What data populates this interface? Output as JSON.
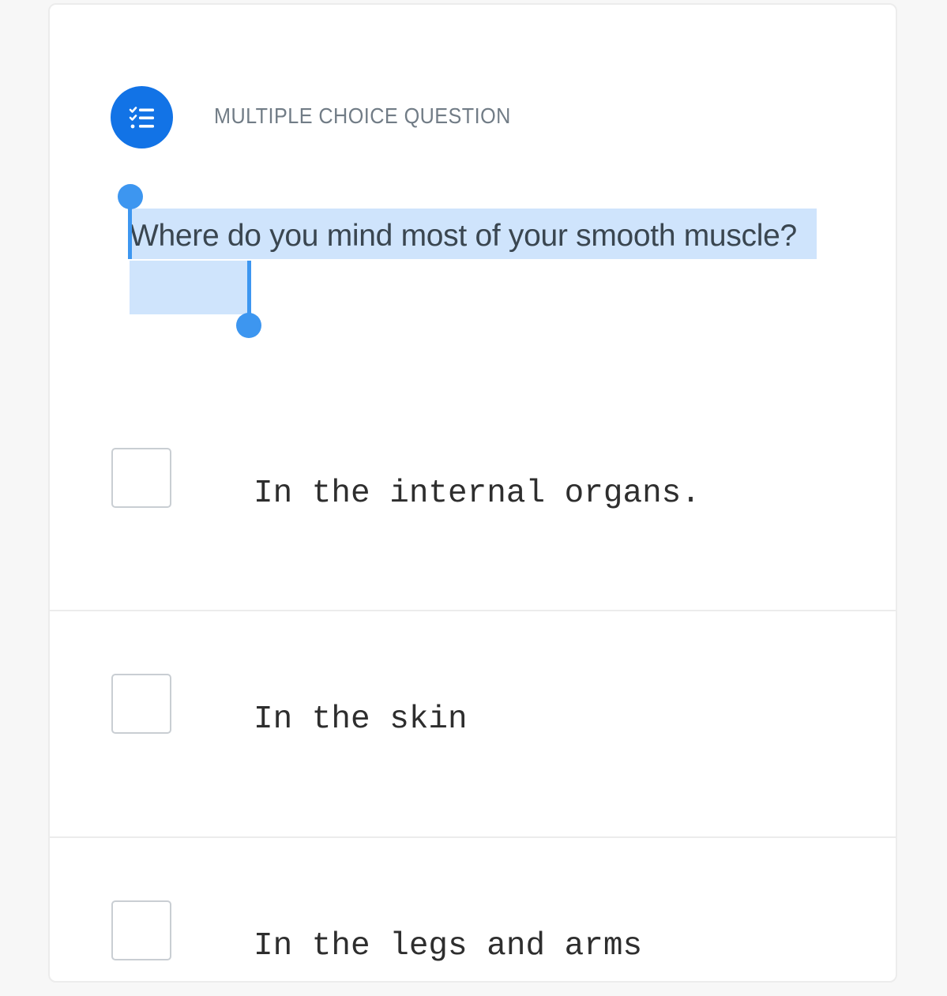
{
  "question": {
    "type_label": "MULTIPLE CHOICE QUESTION",
    "type_icon": "checklist-icon",
    "text": "Where do you mind most of your smooth muscle?",
    "selection_color": "#cfe4fc",
    "handle_color": "#3d96f0"
  },
  "options": [
    {
      "label": "In the internal organs.",
      "checked": false
    },
    {
      "label": "In the skin",
      "checked": false
    },
    {
      "label": "In the legs and arms",
      "checked": false
    }
  ],
  "colors": {
    "accent": "#1273e6",
    "background": "#f7f7f7",
    "card": "#ffffff"
  }
}
